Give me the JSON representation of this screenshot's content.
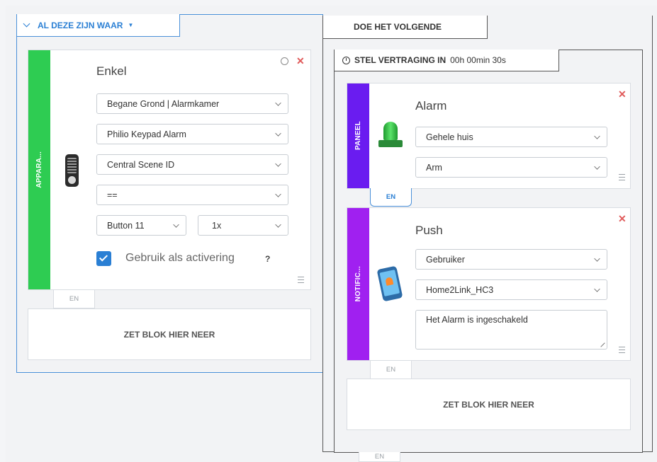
{
  "conditions": {
    "tab_label": "AL DEZE ZIJN WAAR",
    "block": {
      "category": "APPARA...",
      "title": "Enkel",
      "room_select": "Begane Grond | Alarmkamer",
      "device_select": "Philio Keypad Alarm",
      "property_select": "Central Scene ID",
      "operator_select": "==",
      "button_select": "Button 11",
      "press_select": "1x",
      "activation_checked": true,
      "activation_label": "Gebruik als activering",
      "help": "?"
    },
    "connector": "EN",
    "drop_zone": "ZET BLOK HIER NEER"
  },
  "actions": {
    "tab_label": "DOE HET VOLGENDE",
    "delay": {
      "label": "STEL VERTRAGING IN",
      "value": "00h 00min 30s"
    },
    "alarm_block": {
      "category": "PANEEL",
      "title": "Alarm",
      "zone_select": "Gehele huis",
      "mode_select": "Arm"
    },
    "connector_1": "EN",
    "push_block": {
      "category": "NOTIFIC...",
      "title": "Push",
      "user_select": "Gebruiker",
      "target_select": "Home2Link_HC3",
      "message": "Het Alarm is ingeschakeld"
    },
    "connector_2": "EN",
    "drop_zone": "ZET BLOK HIER NEER",
    "connector_3": "EN"
  },
  "colors": {
    "accent_blue": "#2a7fd4",
    "device_green": "#2ecc52",
    "panel_purple": "#6a1cf0",
    "notification_purple": "#a020f0",
    "close_red": "#e05a5a",
    "checkbox_blue": "#2a7fd4"
  },
  "icons": {
    "collapse": "chevron-down-icon",
    "clock": "clock-icon",
    "close": "close-icon",
    "menu": "menu-lines-icon",
    "remote": "remote-control-icon",
    "siren": "siren-icon",
    "phone": "phone-notification-icon"
  }
}
